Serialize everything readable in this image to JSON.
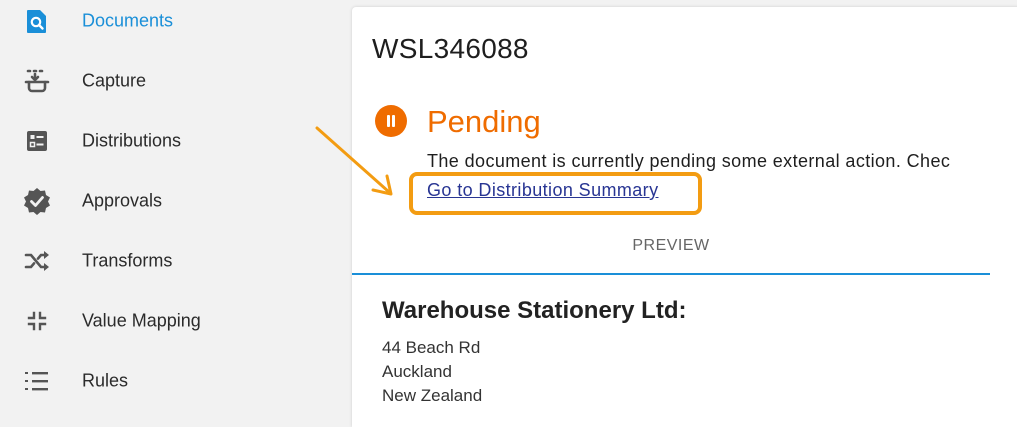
{
  "sidebar": {
    "items": [
      {
        "label": "Documents",
        "icon": "document-search-icon",
        "active": true
      },
      {
        "label": "Capture",
        "icon": "capture-tray-icon",
        "active": false
      },
      {
        "label": "Distributions",
        "icon": "distributions-list-icon",
        "active": false
      },
      {
        "label": "Approvals",
        "icon": "approval-badge-icon",
        "active": false
      },
      {
        "label": "Transforms",
        "icon": "shuffle-icon",
        "active": false
      },
      {
        "label": "Value Mapping",
        "icon": "collapse-arrows-icon",
        "active": false
      },
      {
        "label": "Rules",
        "icon": "numbered-list-icon",
        "active": false
      }
    ]
  },
  "document": {
    "id": "WSL346088",
    "status": "Pending",
    "status_icon": "pause-circle-icon",
    "status_message": "The document is currently pending some external action. Chec",
    "link_text": "Go to Distribution Summary",
    "tab_label": "PREVIEW"
  },
  "preview": {
    "company": "Warehouse Stationery Ltd:",
    "address": [
      "44 Beach Rd",
      "Auckland",
      "New Zealand"
    ]
  },
  "colors": {
    "accent": "#1a8fd8",
    "status_pending": "#ef6c00",
    "annotation": "#f39c12",
    "link": "#283593"
  }
}
